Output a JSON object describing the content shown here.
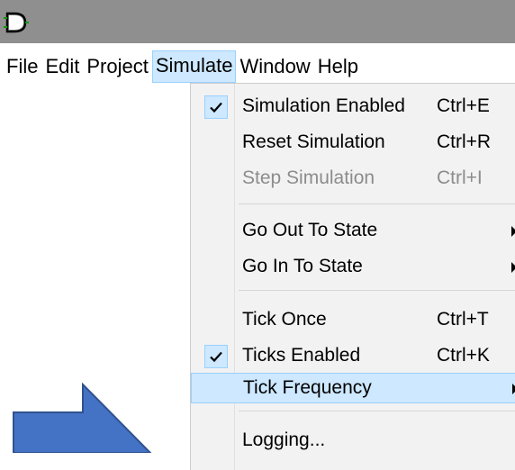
{
  "titlebar": {
    "icon": "logic-gate-icon"
  },
  "menubar": {
    "items": [
      "File",
      "Edit",
      "Project",
      "Simulate",
      "Window",
      "Help"
    ],
    "active": "Simulate"
  },
  "menu": {
    "simulation_enabled": {
      "label": "Simulation Enabled",
      "shortcut": "Ctrl+E",
      "checked": true
    },
    "reset_simulation": {
      "label": "Reset Simulation",
      "shortcut": "Ctrl+R"
    },
    "step_simulation": {
      "label": "Step Simulation",
      "shortcut": "Ctrl+I",
      "disabled": true
    },
    "go_out_to_state": {
      "label": "Go Out To State",
      "submenu": true
    },
    "go_in_to_state": {
      "label": "Go In To State",
      "submenu": true
    },
    "tick_once": {
      "label": "Tick Once",
      "shortcut": "Ctrl+T"
    },
    "ticks_enabled": {
      "label": "Ticks Enabled",
      "shortcut": "Ctrl+K",
      "checked": true
    },
    "tick_frequency": {
      "label": "Tick Frequency",
      "submenu": true,
      "highlighted": true
    },
    "logging": {
      "label": "Logging..."
    }
  },
  "colors": {
    "titlebar": "#8f8f8f",
    "highlight": "#cde8ff",
    "highlight_border": "#99d1ff",
    "arrow_fill": "#4472c4",
    "arrow_stroke": "#2f528f"
  }
}
